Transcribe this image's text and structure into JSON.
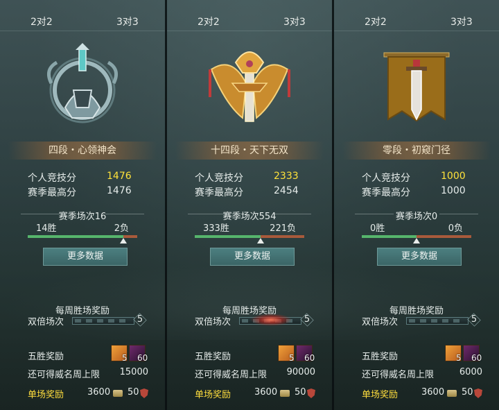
{
  "panels": [
    {
      "tabs": [
        "2对2",
        "3对3"
      ],
      "rank_title": "四段・心领神会",
      "personal_score_label": "个人竞技分",
      "personal_score": "1476",
      "season_best_label": "赛季最高分",
      "season_best": "1476",
      "season_matches": "赛季场次16",
      "wins": "14胜",
      "losses": "2负",
      "win_ratio": 0.875,
      "more_data": "更多数据",
      "weekly_reward_title": "每周胜场奖励",
      "double_label": "双倍场次",
      "double_count": "5",
      "five_win_label": "五胜奖励",
      "reward1_count": "5",
      "reward2_count": "60",
      "fame_limit_label": "还可得威名周上限",
      "fame_limit": "15000",
      "single_reward_label": "单场奖励",
      "single_coin": "3600",
      "single_shield": "50"
    },
    {
      "tabs": [
        "2对2",
        "3对3"
      ],
      "rank_title": "十四段・天下无双",
      "personal_score_label": "个人竞技分",
      "personal_score": "2333",
      "season_best_label": "赛季最高分",
      "season_best": "2454",
      "season_matches": "赛季场次554",
      "wins": "333胜",
      "losses": "221负",
      "win_ratio": 0.601,
      "more_data": "更多数据",
      "weekly_reward_title": "每周胜场奖励",
      "double_label": "双倍场次",
      "double_count": "5",
      "five_win_label": "五胜奖励",
      "reward1_count": "5",
      "reward2_count": "60",
      "fame_limit_label": "还可得威名周上限",
      "fame_limit": "90000",
      "single_reward_label": "单场奖励",
      "single_coin": "3600",
      "single_shield": "50"
    },
    {
      "tabs": [
        "2对2",
        "3对3"
      ],
      "rank_title": "零段・初窥门径",
      "personal_score_label": "个人竞技分",
      "personal_score": "1000",
      "season_best_label": "赛季最高分",
      "season_best": "1000",
      "season_matches": "赛季场次0",
      "wins": "0胜",
      "losses": "0负",
      "win_ratio": 0.5,
      "more_data": "更多数据",
      "weekly_reward_title": "每周胜场奖励",
      "double_label": "双倍场次",
      "double_count": "5",
      "five_win_label": "五胜奖励",
      "reward1_count": "5",
      "reward2_count": "60",
      "fame_limit_label": "还可得威名周上限",
      "fame_limit": "6000",
      "single_reward_label": "单场奖励",
      "single_coin": "3600",
      "single_shield": "50"
    }
  ],
  "colors": {
    "score_highlight": "#ffe23a",
    "single_reward_label": "#ffde3d",
    "win_bar": "#56b56c",
    "loss_bar": "#a85a3b"
  },
  "icons": [
    "silver-helmet-emblem-icon",
    "golden-winged-sword-emblem-icon",
    "banner-sword-emblem-icon",
    "reward-item-icon",
    "reward-gem-icon",
    "coin-icon",
    "shield-icon"
  ]
}
